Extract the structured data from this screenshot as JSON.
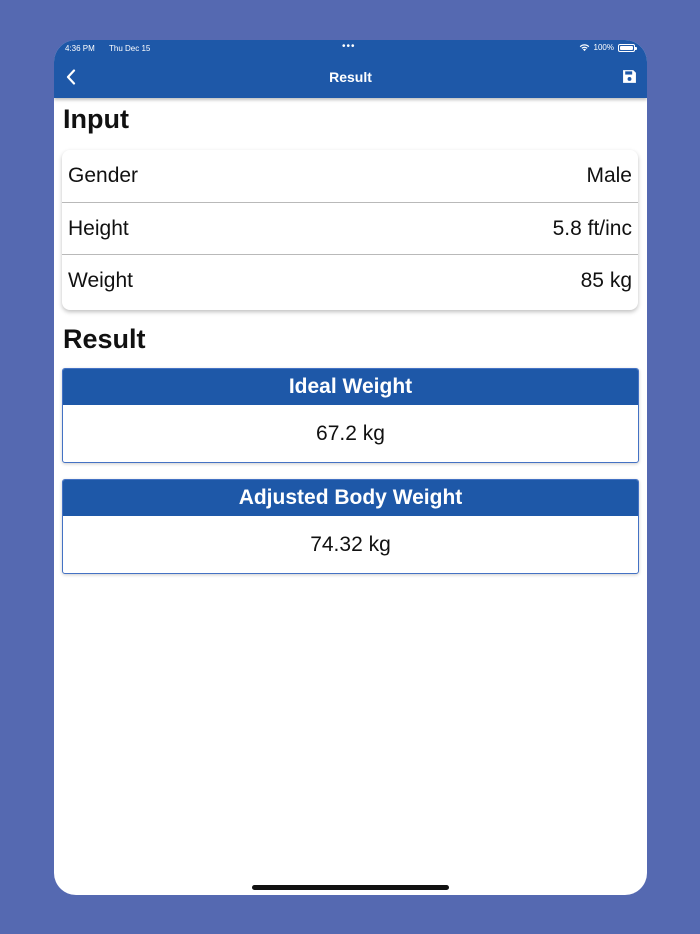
{
  "status_bar": {
    "time": "4:36 PM",
    "date": "Thu Dec 15",
    "dots": "•••",
    "battery": "100%"
  },
  "nav": {
    "title": "Result",
    "back_icon": "chevron-left-icon",
    "save_icon": "floppy-disk-icon"
  },
  "input_section": {
    "title": "Input",
    "rows": [
      {
        "label": "Gender",
        "value": "Male"
      },
      {
        "label": "Height",
        "value": "5.8 ft/inc"
      },
      {
        "label": "Weight",
        "value": "85 kg"
      }
    ]
  },
  "result_section": {
    "title": "Result",
    "cards": [
      {
        "title": "Ideal Weight",
        "value": "67.2 kg"
      },
      {
        "title": "Adjusted Body Weight",
        "value": "74.32 kg"
      }
    ]
  },
  "colors": {
    "background": "#5569b1",
    "header": "#1e58a8",
    "card_border": "#4472c4"
  }
}
